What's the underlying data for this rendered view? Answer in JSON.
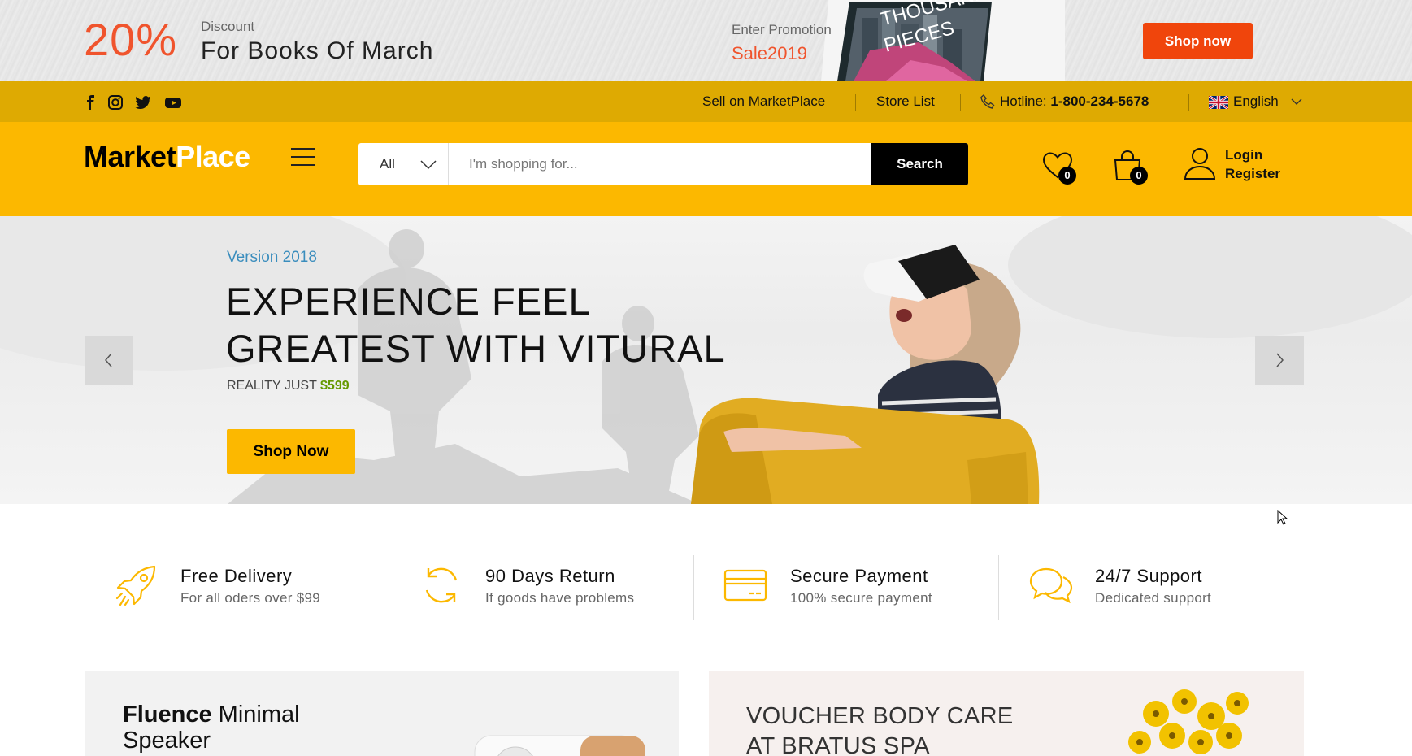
{
  "promo": {
    "percent": "20%",
    "discount_label": "Discount",
    "title": "For Books Of March",
    "enter_label": "Enter Promotion",
    "code": "Sale2019",
    "shop_button": "Shop now",
    "book_cover_text": "A THOUSAND PIECES"
  },
  "topbar": {
    "social_icons": [
      "facebook-icon",
      "instagram-icon",
      "twitter-icon",
      "youtube-icon"
    ],
    "sell_link": "Sell on MarketPlace",
    "store_list": "Store List",
    "hotline_label": "Hotline:",
    "hotline_number": "1-800-234-5678",
    "language": "English"
  },
  "header": {
    "logo_part1": "Market",
    "logo_part2": "Place",
    "search": {
      "category": "All",
      "placeholder": "I'm shopping for...",
      "button": "Search"
    },
    "wishlist_count": "0",
    "cart_count": "0",
    "login": "Login",
    "register": "Register"
  },
  "hero": {
    "version": "Version 2018",
    "title_line1": "EXPERIENCE FEEL",
    "title_line2": "GREATEST WITH VITURAL",
    "subtitle": "REALITY JUST",
    "price": "$599",
    "button": "Shop Now"
  },
  "features": [
    {
      "icon": "rocket-icon",
      "title": "Free Delivery",
      "subtitle": "For all oders over $99"
    },
    {
      "icon": "refresh-icon",
      "title": "90 Days Return",
      "subtitle": "If goods have problems"
    },
    {
      "icon": "credit-card-icon",
      "title": "Secure Payment",
      "subtitle": "100% secure payment"
    },
    {
      "icon": "chat-icon",
      "title": "24/7 Support",
      "subtitle": "Dedicated support"
    }
  ],
  "banners": {
    "left_bold": "Fluence",
    "left_rest": "Minimal",
    "left_line2": "Speaker",
    "right_line1": "VOUCHER BODY CARE",
    "right_line2": "AT BRATUS SPA"
  },
  "colors": {
    "brand_yellow": "#fcb800",
    "topbar_yellow": "#deaa02",
    "accent_orange": "#f0542d",
    "price_green": "#669900",
    "version_blue": "#3a8dbd"
  }
}
